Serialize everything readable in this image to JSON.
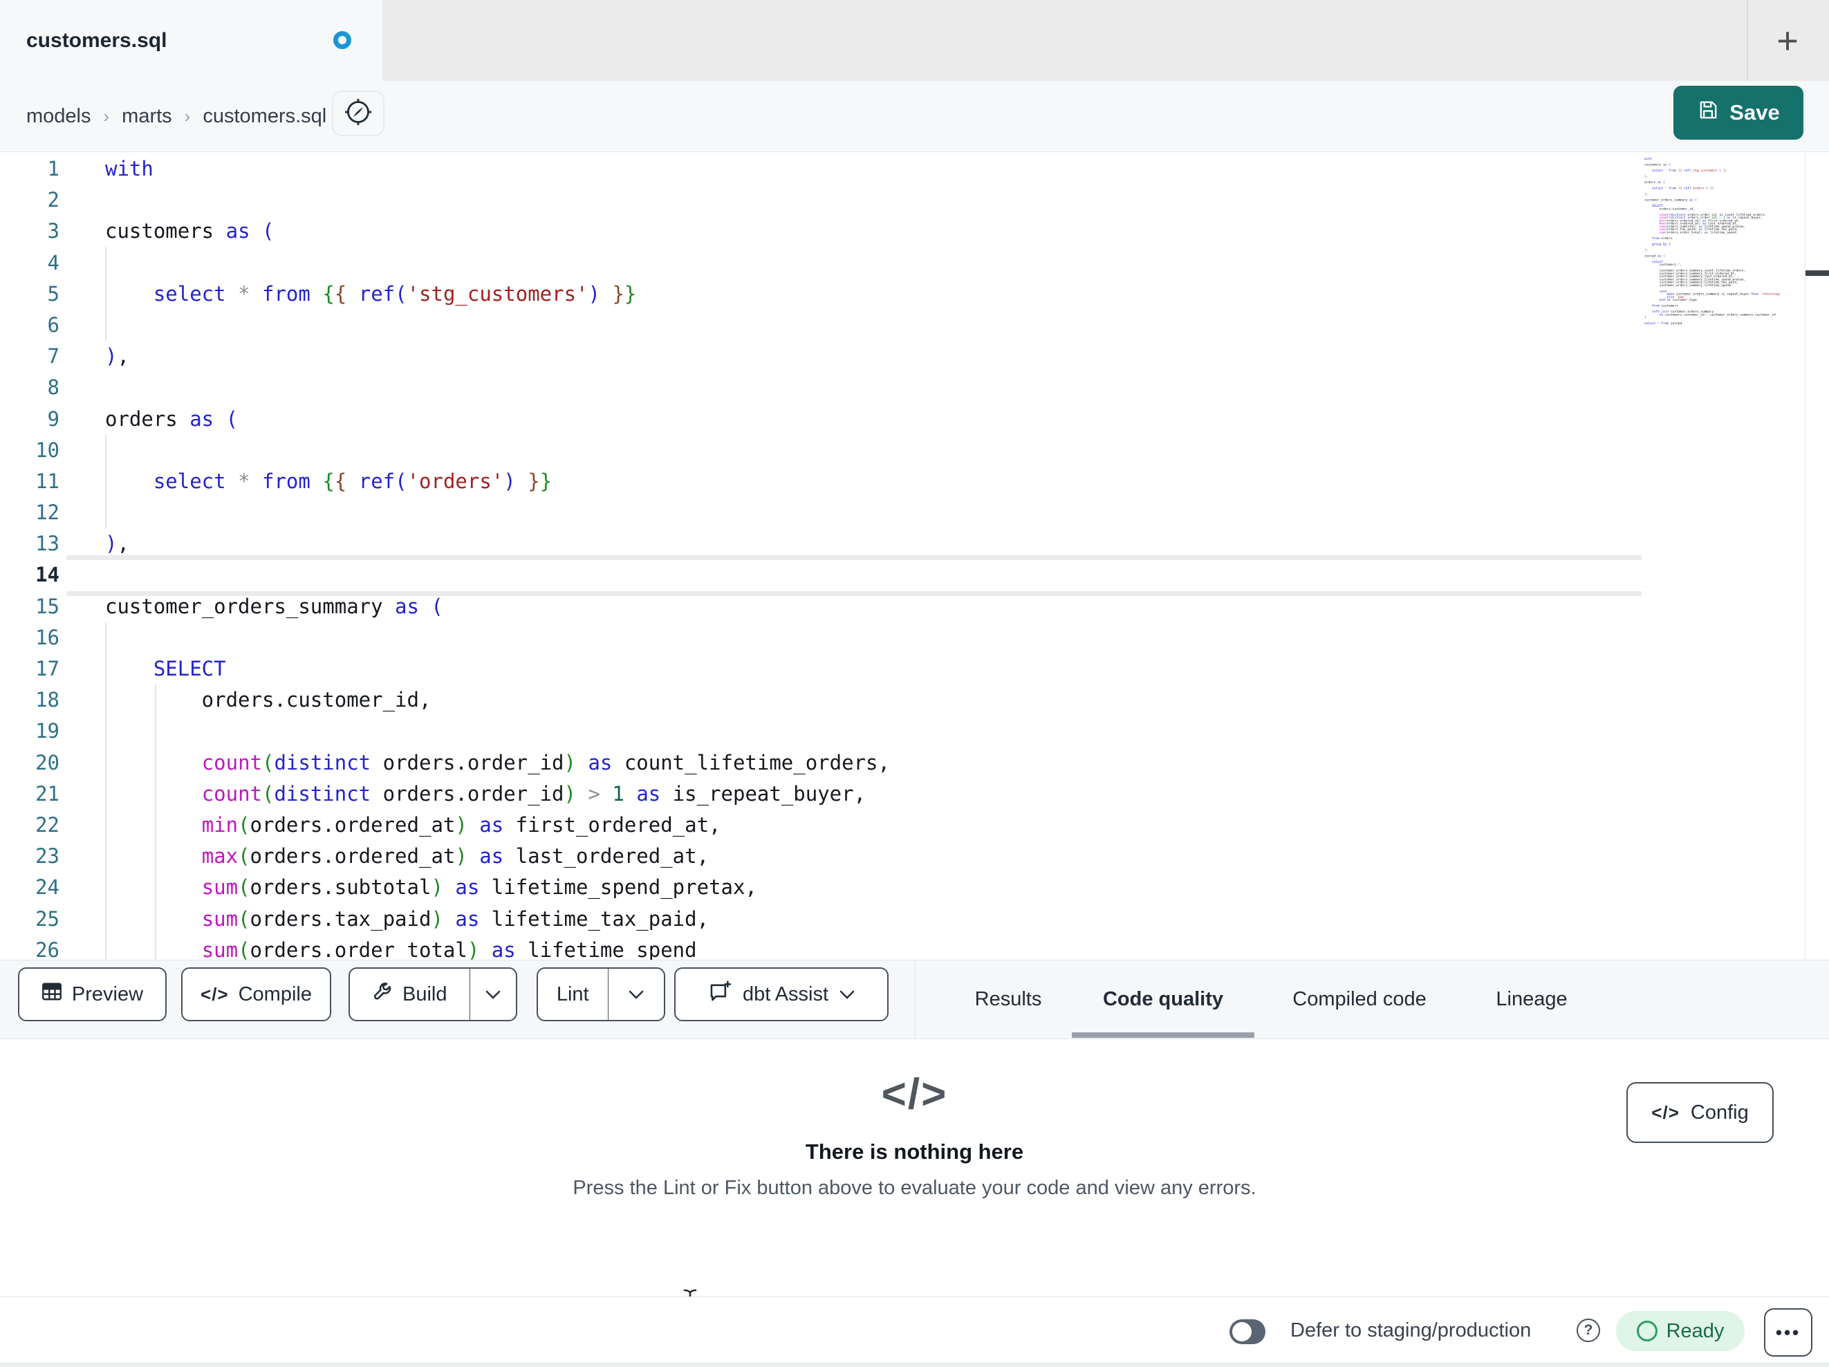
{
  "tabbar": {
    "title": "customers.sql",
    "new_tab": "+"
  },
  "breadcrumb": {
    "items": [
      "models",
      "marts",
      "customers.sql"
    ],
    "separator": "›"
  },
  "save": {
    "label": "Save"
  },
  "editor": {
    "active_line": 14,
    "visible_lines": 26,
    "file_lines": [
      "with",
      "",
      "customers as (",
      "",
      "    select * from {{ ref('stg_customers') }}",
      "",
      "),",
      "",
      "orders as (",
      "",
      "    select * from {{ ref('orders') }}",
      "",
      "),",
      "",
      "customer_orders_summary as (",
      "",
      "    SELECT",
      "        orders.customer_id,",
      "",
      "        count(distinct orders.order_id) as count_lifetime_orders,",
      "        count(distinct orders.order_id) > 1 as is_repeat_buyer,",
      "        min(orders.ordered_at) as first_ordered_at,",
      "        max(orders.ordered_at) as last_ordered_at,",
      "        sum(orders.subtotal) as lifetime_spend_pretax,",
      "        sum(orders.tax_paid) as lifetime_tax_paid,",
      "        sum(orders.order_total) as lifetime_spend",
      "",
      "    from orders",
      "",
      "    group by 1",
      "",
      "),",
      "",
      "joined as (",
      "",
      "    select",
      "        customers.*,",
      "",
      "        customer_orders_summary.count_lifetime_orders,",
      "        customer_orders_summary.first_ordered_at,",
      "        customer_orders_summary.last_ordered_at,",
      "        customer_orders_summary.lifetime_spend_pretax,",
      "        customer_orders_summary.lifetime_tax_paid,",
      "        customer_orders_summary.lifetime_spend,",
      "",
      "        case",
      "            when customer_orders_summary.is_repeat_buyer then 'returning'",
      "            else 'new'",
      "        end as customer_type",
      "",
      "    from customers",
      "",
      "    left join customer_orders_summary",
      "        on customers.customer_id = customer_orders_summary.customer_id",
      ")",
      "",
      "select * from joined"
    ],
    "syntax_colors": {
      "keyword": "#2323cc",
      "function": "#bf16bf",
      "string": "#a32020",
      "number": "#116644",
      "operator": "#8a8f96",
      "bracket_level0": "#2323cc",
      "bracket_level1": "#1f8a1f",
      "bracket_level2": "#8b4726",
      "text": "#15181d",
      "line_number": "#2f7186",
      "active_line_number": "#1b2735"
    }
  },
  "toolbar": {
    "preview": "Preview",
    "compile": "Compile",
    "compile_icon": "</>",
    "build": "Build",
    "lint": "Lint",
    "assist": "dbt Assist"
  },
  "tabs": [
    {
      "label": "Results",
      "active": false
    },
    {
      "label": "Code quality",
      "active": true
    },
    {
      "label": "Compiled code",
      "active": false
    },
    {
      "label": "Lineage",
      "active": false
    }
  ],
  "panel": {
    "icon": "</>",
    "title": "There is nothing here",
    "subtitle": "Press the Lint or Fix button above to evaluate your code and view any errors.",
    "config_icon": "</>",
    "config": "Config"
  },
  "statusbar": {
    "defer_label": "Defer to staging/production",
    "help": "?",
    "ready": "Ready",
    "menu": "•••"
  },
  "ui_colors": {
    "save_button_bg": "#15716b",
    "unsaved_dot": "#1a96d6",
    "ready_pill_bg": "#dff5e8",
    "ready_text": "#1a6b45",
    "ready_ring": "#2f9e63",
    "active_tab_underline": "#9aa1ab",
    "toggle_off_bg": "#5a6472",
    "tabbar_bg": "#ebebeb",
    "toolbar_bg": "#f6f7f8"
  }
}
